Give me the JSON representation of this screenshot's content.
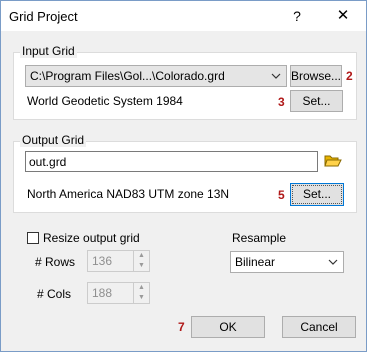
{
  "window": {
    "title": "Grid Project",
    "help_glyph": "?",
    "close_glyph": "✕"
  },
  "input_grid": {
    "label": "Input Grid",
    "file_value": "C:\\Program Files\\Gol...\\Colorado.grd",
    "browse_label": "Browse...",
    "browse_marker": "2",
    "projection": "World Geodetic System 1984",
    "set_marker": "3",
    "set_label": "Set..."
  },
  "output_grid": {
    "label": "Output Grid",
    "file_value": "out.grd",
    "projection": "North America NAD83 UTM zone 13N",
    "set_marker": "5",
    "set_label": "Set..."
  },
  "resize": {
    "checkbox_label": "Resize output grid",
    "checked": false,
    "rows_label": "# Rows",
    "rows_value": "136",
    "cols_label": "# Cols",
    "cols_value": "188"
  },
  "resample": {
    "label": "Resample",
    "selected": "Bilinear"
  },
  "footer": {
    "ok_marker": "7",
    "ok_label": "OK",
    "cancel_label": "Cancel"
  },
  "colors": {
    "marker": "#b01818",
    "focus_border": "#0078d7",
    "folder_icon": "#e8b400"
  },
  "icons": {
    "folder": "open-folder-icon",
    "dropdown": "chevron-down-icon"
  }
}
